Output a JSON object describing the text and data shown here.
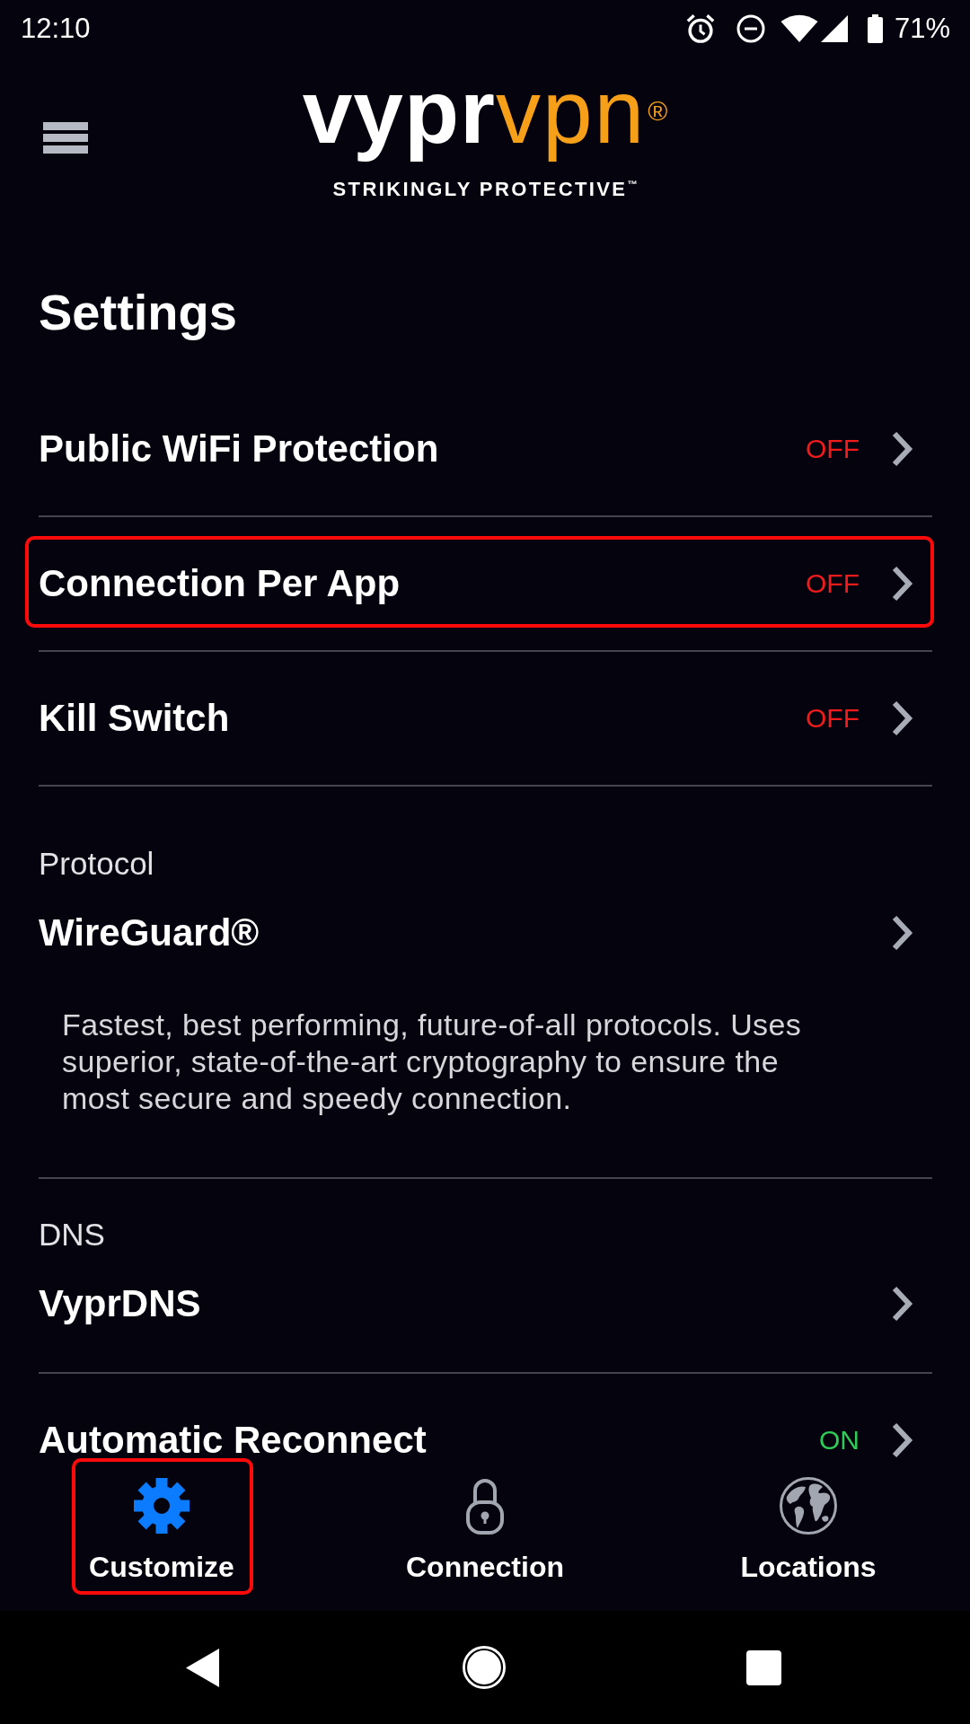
{
  "status_bar": {
    "time": "12:10",
    "battery": "71%"
  },
  "header": {
    "logo_text": "vypr",
    "logo_accent": "vpn",
    "logo_mark": "®",
    "tagline": "STRIKINGLY PROTECTIVE$^{™}$"
  },
  "page_title": "Settings",
  "settings": [
    {
      "kind": "toggle",
      "title": "Public WiFi Protection",
      "value": "OFF",
      "on": false,
      "highlighted": false
    },
    {
      "kind": "toggle",
      "title": "Connection Per App",
      "value": "OFF",
      "on": false,
      "highlighted": true
    },
    {
      "kind": "toggle",
      "title": "Kill Switch",
      "value": "OFF",
      "on": false,
      "highlighted": false
    },
    {
      "kind": "choice",
      "label": "Protocol",
      "title": "WireGuard®",
      "description": "Fastest, best performing, future-of-all protocols. Uses superior, state-of-the-art cryptography to ensure the most secure and speedy connection.",
      "highlighted": false
    },
    {
      "kind": "choice",
      "label": "DNS",
      "title": "VyprDNS",
      "highlighted": false
    },
    {
      "kind": "toggle",
      "title": "Automatic Reconnect",
      "value": "ON",
      "on": true,
      "highlighted": false
    }
  ],
  "bottom_nav": [
    {
      "label": "Customize",
      "selected": true,
      "highlighted": true
    },
    {
      "label": "Connection",
      "selected": false,
      "highlighted": false
    },
    {
      "label": "Locations",
      "selected": false,
      "highlighted": false
    }
  ]
}
